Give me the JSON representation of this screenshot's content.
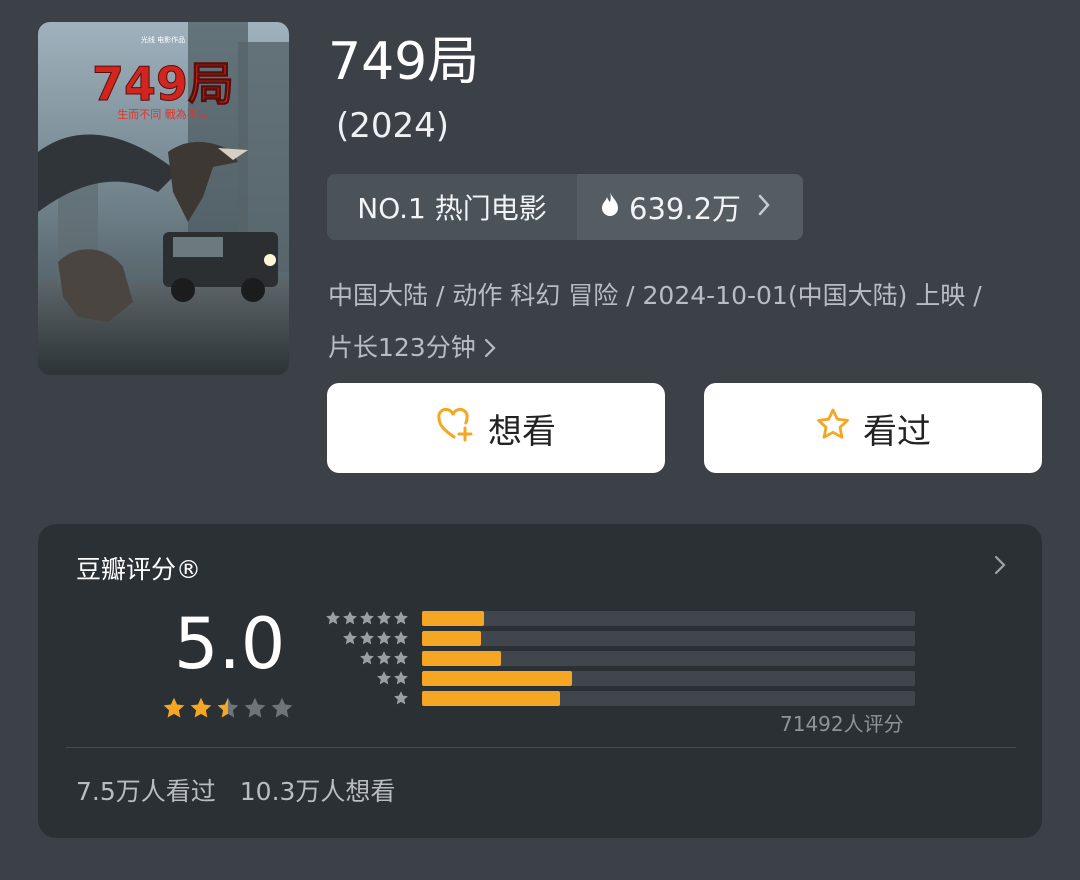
{
  "movie": {
    "title": "749局",
    "year": "(2024)",
    "poster": {
      "title_text": "749局",
      "tagline": "生而不同  戰為不同",
      "producer": "光线 电影作品"
    }
  },
  "rank": {
    "label": "NO.1 热门电影",
    "heat": "639.2万"
  },
  "meta": {
    "line1": "中国大陆 / 动作 科幻 冒险 / 2024-10-01(中国大陆) 上映 /",
    "line2": "片长123分钟"
  },
  "actions": {
    "want_label": "想看",
    "seen_label": "看过"
  },
  "rating": {
    "title": "豆瓣评分®",
    "score": "5.0",
    "score_stars": 2.5,
    "votes_text": "71492人评分",
    "distribution": [
      {
        "stars": 5,
        "percent": 12.5
      },
      {
        "stars": 4,
        "percent": 12.0
      },
      {
        "stars": 3,
        "percent": 16.0
      },
      {
        "stars": 2,
        "percent": 30.5
      },
      {
        "stars": 1,
        "percent": 28.0
      }
    ],
    "seen_count": "7.5万人看过",
    "want_count": "10.3万人想看"
  },
  "colors": {
    "accent": "#f5a623",
    "background": "#3b4147",
    "card": "#2b3035"
  }
}
